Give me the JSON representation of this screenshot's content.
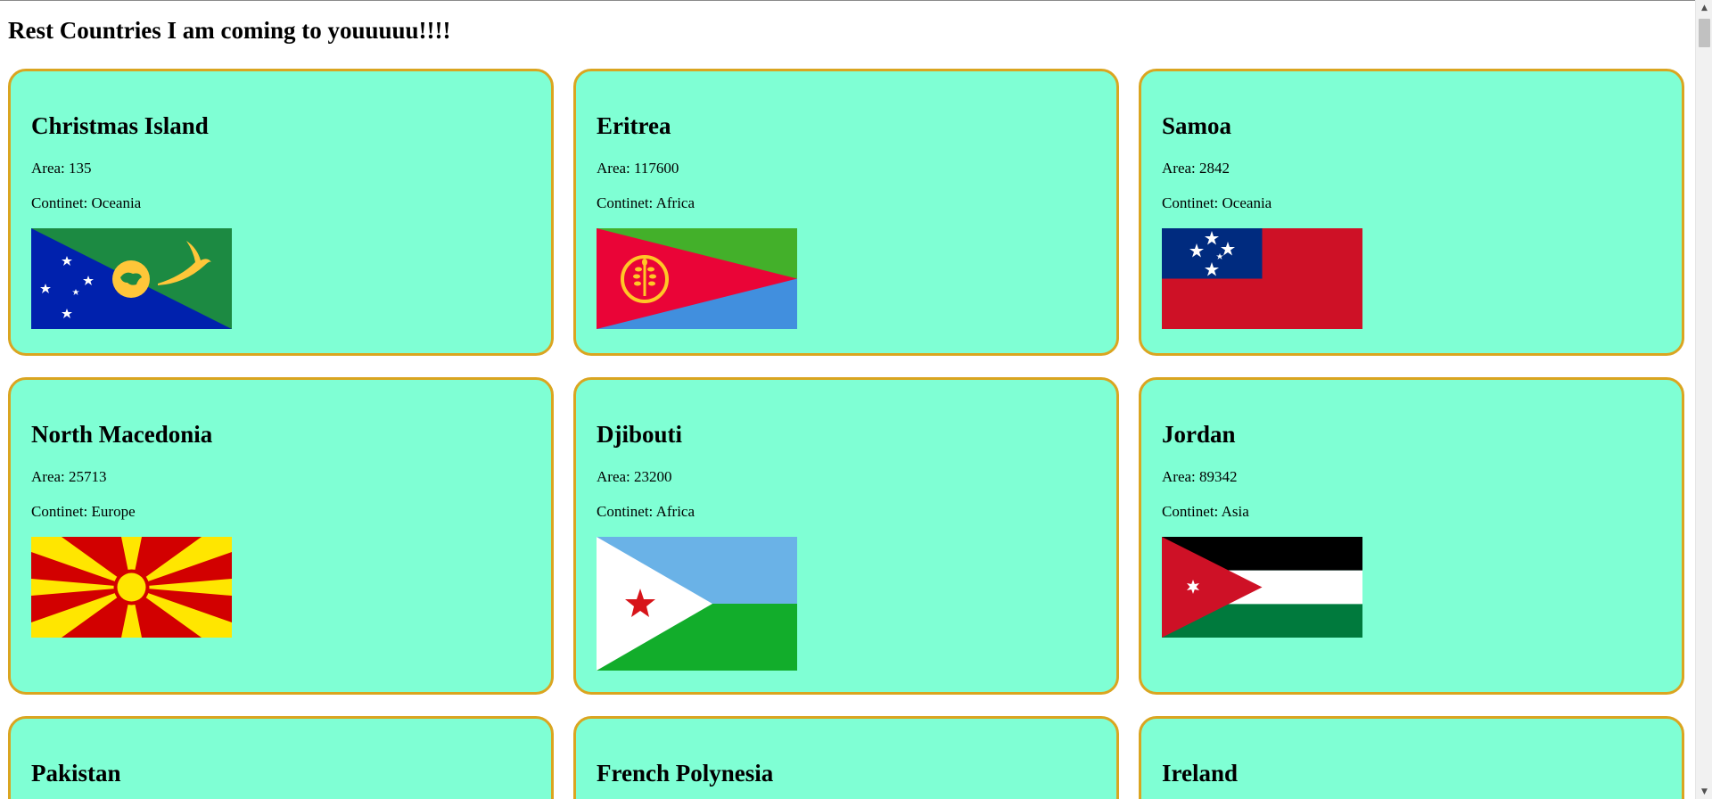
{
  "page": {
    "title": "Rest Countries I am coming to youuuuu!!!!"
  },
  "countries": [
    {
      "name": "Christmas Island",
      "area": "Area: 135",
      "continent": "Continet: Oceania",
      "flag_icon": "christmas-island-flag"
    },
    {
      "name": "Eritrea",
      "area": "Area: 117600",
      "continent": "Continet: Africa",
      "flag_icon": "eritrea-flag"
    },
    {
      "name": "Samoa",
      "area": "Area: 2842",
      "continent": "Continet: Oceania",
      "flag_icon": "samoa-flag"
    },
    {
      "name": "North Macedonia",
      "area": "Area: 25713",
      "continent": "Continet: Europe",
      "flag_icon": "north-macedonia-flag"
    },
    {
      "name": "Djibouti",
      "area": "Area: 23200",
      "continent": "Continet: Africa",
      "flag_icon": "djibouti-flag"
    },
    {
      "name": "Jordan",
      "area": "Area: 89342",
      "continent": "Continet: Asia",
      "flag_icon": "jordan-flag"
    },
    {
      "name": "Pakistan"
    },
    {
      "name": "French Polynesia"
    },
    {
      "name": "Ireland"
    }
  ],
  "colors": {
    "card_background": "#7fffd4",
    "card_border": "#daa520"
  },
  "scrollbar": {
    "up_icon": "scroll-up-arrow-icon",
    "down_icon": "scroll-down-arrow-icon"
  }
}
